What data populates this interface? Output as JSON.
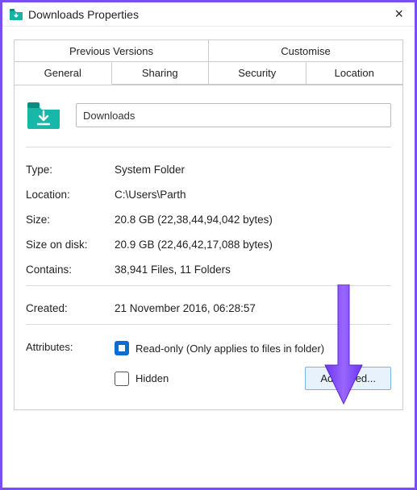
{
  "titlebar": {
    "title": "Downloads Properties",
    "close_label": "×"
  },
  "tabs": {
    "previous_versions": "Previous Versions",
    "customise": "Customise",
    "general": "General",
    "sharing": "Sharing",
    "security": "Security",
    "location": "Location"
  },
  "active_tab": "general",
  "folder_name": "Downloads",
  "fields": {
    "type_label": "Type:",
    "type_value": "System Folder",
    "location_label": "Location:",
    "location_value": "C:\\Users\\Parth",
    "size_label": "Size:",
    "size_value": "20.8 GB (22,38,44,94,042 bytes)",
    "size_on_disk_label": "Size on disk:",
    "size_on_disk_value": "20.9 GB (22,46,42,17,088 bytes)",
    "contains_label": "Contains:",
    "contains_value": "38,941 Files, 11 Folders",
    "created_label": "Created:",
    "created_value": "21 November 2016, 06:28:57",
    "attributes_label": "Attributes:",
    "readonly_label": "Read-only (Only applies to files in folder)",
    "hidden_label": "Hidden",
    "advanced_button": "Advanced..."
  },
  "attributes": {
    "readonly_checked": true,
    "hidden_checked": false
  },
  "overlay": {
    "arrow_color": "#7a4ef2"
  }
}
